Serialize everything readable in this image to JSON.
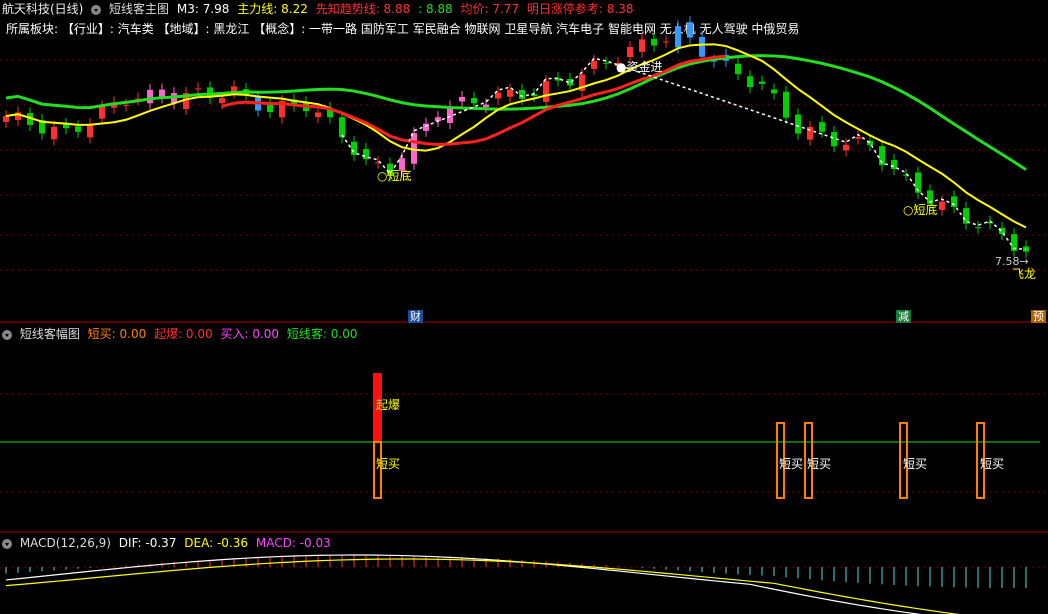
{
  "main_header": {
    "stock": "航天科技(日线)",
    "indicator": "短线客主图",
    "m3": "M3: 7.98",
    "zhuli": "主力线: 8.22",
    "xianzhi": "先知趋势线: 8.88",
    "val2": ": 8.88",
    "junjia": "均价: 7.77",
    "mingri": "明日涨停参考: 8.38"
  },
  "sector_line": "所属板块: 【行业】: 汽车类 【地域】: 黑龙江 【概念】: 一带一路 国防军工 军民融合 物联网 卫星导航 汽车电子 智能电网 无人机 无人驾驶 中俄贸易",
  "annotations": {
    "duandi1": "短底",
    "duandi2": "短底",
    "zijin": "资金进",
    "price_low": "7.58",
    "feilong": "飞龙"
  },
  "badges": {
    "cai": "财",
    "jian": "减",
    "yu": "预"
  },
  "panel2_header": {
    "title": "短线客幅图",
    "duanmai": "短买: 0.00",
    "qibao": "起爆: 0.00",
    "mairu": "买入: 0.00",
    "duanxianke": "短线客: 0.00"
  },
  "panel2_labels": {
    "qibao": "起爆",
    "duanmai": "短买"
  },
  "macd_header": {
    "title": "MACD(12,26,9)",
    "dif": "DIF: -0.37",
    "dea": "DEA: -0.36",
    "macd": "MACD: -0.03"
  },
  "colors": {
    "up": "#ff3030",
    "down": "#00d000",
    "pink": "#ff66cc",
    "blue": "#3399ff",
    "yellow": "#ffff00",
    "green_line": "#22dd22",
    "red_line": "#ff2020",
    "orange": "#ff8000"
  },
  "chart_data": [
    {
      "type": "candlestick",
      "title": "短线客主图",
      "series": [
        {
          "name": "主力线",
          "values": [
            8.22
          ]
        },
        {
          "name": "先知趋势线",
          "values": [
            8.88
          ]
        },
        {
          "name": "M3",
          "values": [
            7.98
          ]
        }
      ],
      "annotations": [
        "短底",
        "短底",
        "资金进",
        "7.58",
        "飞龙"
      ]
    },
    {
      "type": "bar",
      "title": "短线客幅图",
      "series": [
        {
          "name": "短买",
          "values": [
            0.0
          ]
        },
        {
          "name": "起爆",
          "values": [
            0.0
          ]
        },
        {
          "name": "买入",
          "values": [
            0.0
          ]
        },
        {
          "name": "短线客",
          "values": [
            0.0
          ]
        }
      ]
    },
    {
      "type": "line",
      "title": "MACD(12,26,9)",
      "series": [
        {
          "name": "DIF",
          "values": [
            -0.37
          ]
        },
        {
          "name": "DEA",
          "values": [
            -0.36
          ]
        },
        {
          "name": "MACD",
          "values": [
            -0.03
          ]
        }
      ]
    }
  ]
}
